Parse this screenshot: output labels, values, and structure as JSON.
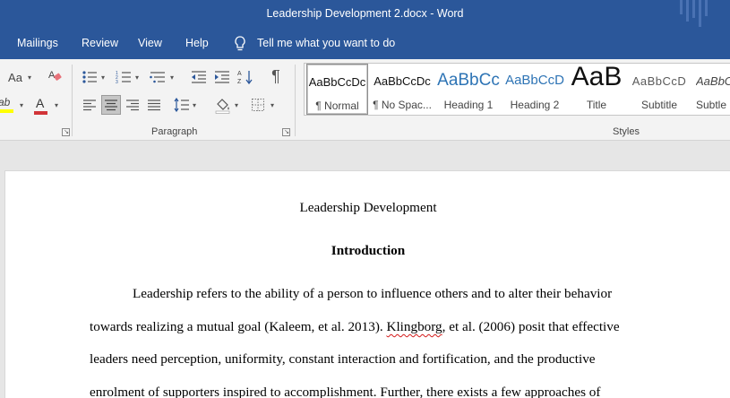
{
  "window": {
    "title": "Leadership Development 2.docx  -  Word"
  },
  "tabs": {
    "items": [
      "Mailings",
      "Review",
      "View",
      "Help"
    ],
    "tell_me": "Tell me what you want to do"
  },
  "ribbon": {
    "font_group": {
      "change_case": "Aa",
      "highlight_label": "ab",
      "font_color_label": "A",
      "colors": {
        "highlight": "#ffff00",
        "font_color": "#d13438"
      }
    },
    "paragraph_group": {
      "label": "Paragraph",
      "show_marks_glyph": "¶",
      "active": "align-center"
    },
    "styles_group": {
      "label": "Styles",
      "items": [
        {
          "preview": "AaBbCcDc",
          "name": "¶ Normal"
        },
        {
          "preview": "AaBbCcDc",
          "name": "¶ No Spac..."
        },
        {
          "preview": "AaBbCc",
          "name": "Heading 1"
        },
        {
          "preview": "AaBbCcD",
          "name": "Heading 2"
        },
        {
          "preview": "AaB",
          "name": "Title"
        },
        {
          "preview": "AaBbCcD",
          "name": "Subtitle"
        },
        {
          "preview": "AaBbCcD",
          "name": "Subtle E"
        }
      ],
      "selected": "¶ Normal"
    }
  },
  "document": {
    "title": "Leadership Development",
    "heading": "Introduction",
    "lines": [
      "Leadership refers to the ability of a person to influence others and to alter their behavior",
      "towards realizing a mutual goal (Kaleem, et al. 2013).",
      "Klingborg",
      ", et al. (2006) posit that effective",
      "leaders need perception, uniformity, constant interaction and fortification, and the productive",
      "enrolment of supporters inspired to accomplishment. Further, there exists a few approaches of"
    ]
  },
  "colors": {
    "title_bar": "#2b579a",
    "ribbon_bg": "#f3f3f3",
    "page_bg": "#ffffff",
    "spell_error": "#d31a1a",
    "heading_blue": "#2e74b5"
  }
}
